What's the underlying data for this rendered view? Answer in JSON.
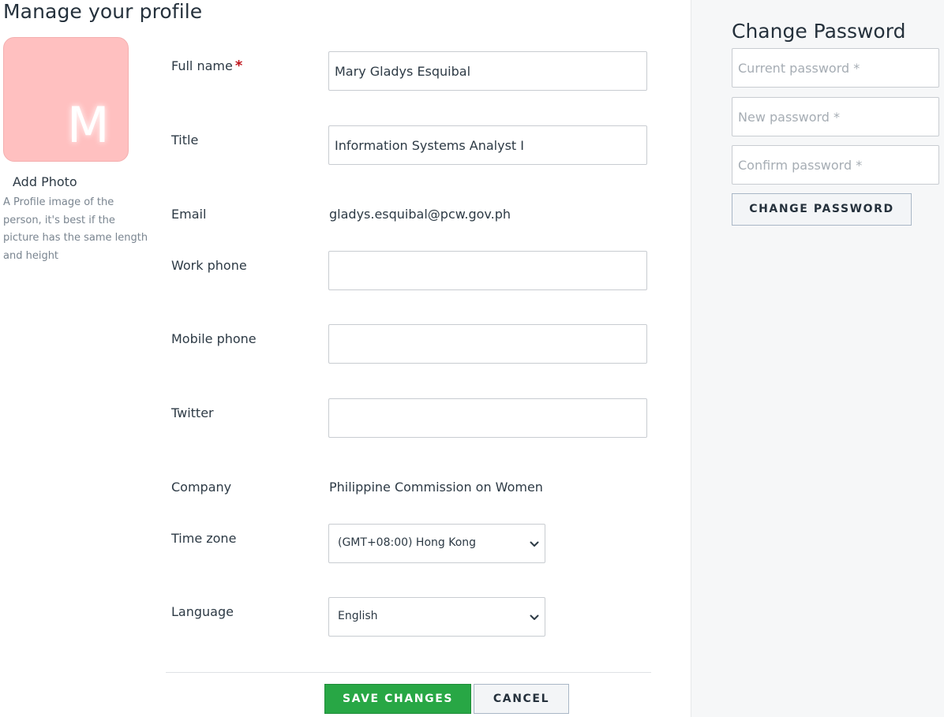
{
  "page": {
    "title": "Manage your profile"
  },
  "photo": {
    "initial": "M",
    "avatar_color": "#ffc0c0",
    "add_label": "Add Photo",
    "help_text": "A Profile image of the person, it's best if the picture has the same length and height"
  },
  "form": {
    "required_mark": "*",
    "full_name": {
      "label": "Full name",
      "value": "Mary Gladys Esquibal"
    },
    "title": {
      "label": "Title",
      "value": "Information Systems Analyst I"
    },
    "email": {
      "label": "Email",
      "value": "gladys.esquibal@pcw.gov.ph"
    },
    "work_phone": {
      "label": "Work phone",
      "value": ""
    },
    "mobile_phone": {
      "label": "Mobile phone",
      "value": ""
    },
    "twitter": {
      "label": "Twitter",
      "value": ""
    },
    "company": {
      "label": "Company",
      "value": "Philippine Commission on Women"
    },
    "time_zone": {
      "label": "Time zone",
      "value": "(GMT+08:00) Hong Kong"
    },
    "language": {
      "label": "Language",
      "value": "English"
    }
  },
  "actions": {
    "save_label": "SAVE CHANGES",
    "cancel_label": "CANCEL",
    "save_color": "#28a745"
  },
  "password": {
    "title": "Change Password",
    "current_placeholder": "Current password *",
    "new_placeholder": "New password *",
    "confirm_placeholder": "Confirm password *",
    "button_label": "CHANGE PASSWORD"
  },
  "icons": {
    "select_chevron": "chevron-down-icon"
  }
}
